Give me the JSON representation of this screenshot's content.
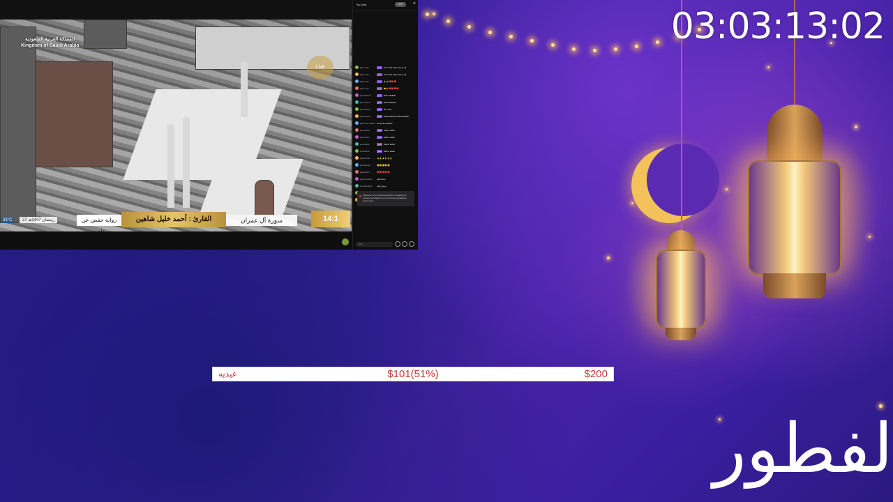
{
  "stream": {
    "country_ar": "المملكة العربية السعودية",
    "country_en": "Kingdom of Saudi Arabia",
    "live_label": "Live",
    "reciter": "القارئ : أحمد خليل شاهين",
    "surah": "سورة آل عمران",
    "riwaya": "رواية حفص عن عاصم",
    "time": "14:1",
    "temp": "33°C",
    "date": "27 رمضان 1447هـ"
  },
  "chat": {
    "title": "Top chat",
    "badge": "GMT",
    "close_icon": "×",
    "notice_text": "Welcome to live chat! Remember to guard your privacy and abide by our community guidelines. Learn more",
    "input_placeholder": "Chat...",
    "messages": [
      {
        "name": "@LO-olO",
        "tag": "مدير",
        "text": "Don't fast when Heun 🙏"
      },
      {
        "name": "@LO-olO",
        "tag": "مدير",
        "text": "Don't fast when Heun 🙏"
      },
      {
        "name": "@LO-olO",
        "tag": "مدير",
        "text": "🙏🙏❤️❤️❤️"
      },
      {
        "name": "@LO-olO",
        "tag": "مدير",
        "text": "🤲🙏❤️❤️❤️❤️"
      },
      {
        "name": "jannhaboon",
        "tag": "مدير",
        "text": "alhamdulillah"
      },
      {
        "name": "jannhaboon",
        "tag": "مدير",
        "text": "Alhamdulillah"
      },
      {
        "name": "jannhaboon",
        "tag": "مدير",
        "text": "الحمد لله"
      },
      {
        "name": "jannhaboon",
        "tag": "مدير",
        "text": "Alhamdulillah Alhamdulillah"
      },
      {
        "name": "@muhammaden",
        "tag": "",
        "text": "ALLAHU AKBAR"
      },
      {
        "name": "janibsahib",
        "tag": "مدير",
        "text": "Allahu akbar"
      },
      {
        "name": "janibsahib",
        "tag": "مدير",
        "text": "Allahu akbar"
      },
      {
        "name": "janibsahib",
        "tag": "مدير",
        "text": "Allahu akbar"
      },
      {
        "name": "janibsahib",
        "tag": "مدير",
        "text": "Allahu akbar"
      },
      {
        "name": "@saldullah",
        "tag": "",
        "text": "🙏🙏🙏🙏🙏🙏"
      },
      {
        "name": "@saldullah",
        "tag": "",
        "text": "😢😢😢😢😢"
      },
      {
        "name": "@patkhan",
        "tag": "",
        "text": "❤️❤️❤️❤️❤️"
      },
      {
        "name": "@jamaluddin",
        "tag": "",
        "text": "ماشاء الله"
      },
      {
        "name": "@hasanlikeb",
        "tag": "",
        "text": "سبحان الله"
      },
      {
        "name": "@ahmadrahim",
        "tag": "",
        "text": "الحمد لله"
      },
      {
        "name": "@salim",
        "tag": "",
        "text": "الله أكبر"
      }
    ]
  },
  "countdown": "03:03:13:02",
  "goal": {
    "label": "عيديه",
    "current": "$101(51%)",
    "max": "$200",
    "progress_fraction": 0.51
  },
  "title_ar": "لفطور",
  "colors": {
    "goal_text": "#c23a3a",
    "gold": "#e6c46a",
    "chat_tag": "#7c53d6"
  }
}
